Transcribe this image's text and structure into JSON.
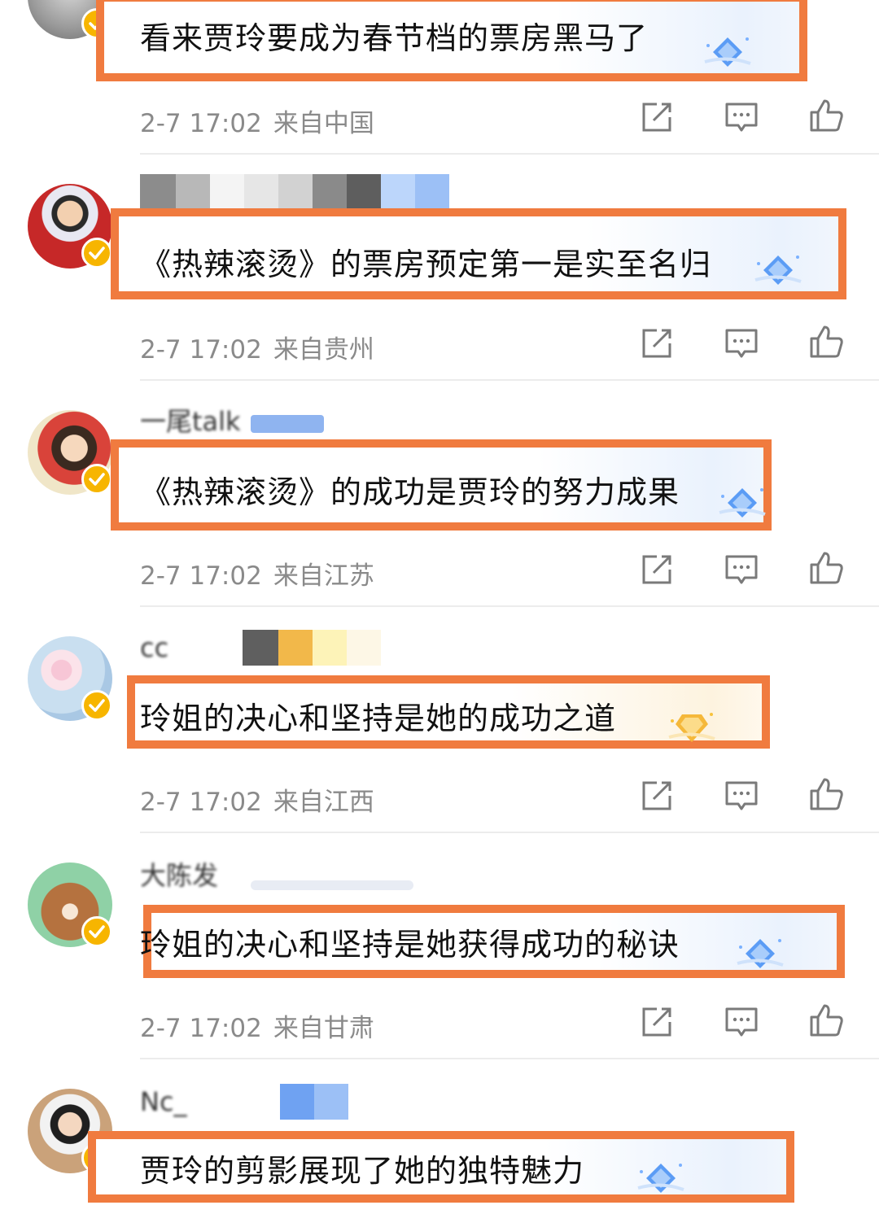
{
  "comments": [
    {
      "text": "看来贾玲要成为春节档的票房黑马了",
      "time": "2-7 17:02",
      "location": "来自中国",
      "badge_color": "#7bb1ff"
    },
    {
      "text": "《热辣滚烫》的票房预定第一是实至名归",
      "time": "2-7 17:02",
      "location": "来自贵州",
      "badge_color": "#7bb1ff"
    },
    {
      "text": "《热辣滚烫》的成功是贾玲的努力成果",
      "time": "2-7 17:02",
      "location": "来自江苏",
      "badge_color": "#7bb1ff"
    },
    {
      "text": "玲姐的决心和坚持是她的成功之道",
      "time": "2-7 17:02",
      "location": "来自江西",
      "badge_color": "#f7c23b"
    },
    {
      "text": "玲姐的决心和坚持是她获得成功的秘诀",
      "time": "2-7 17:02",
      "location": "来自甘肃",
      "badge_color": "#7bb1ff"
    },
    {
      "text": "贾玲的剪影展现了她的独特魅力",
      "time": "",
      "location": "",
      "badge_color": "#7bb1ff"
    }
  ],
  "usernames": {
    "u3": "一尾talk",
    "u4": "cc",
    "u5": "大陈发",
    "u6": "Nc_"
  },
  "icons": {
    "share": "share-icon",
    "comment": "comment-icon",
    "like": "like-icon",
    "verified": "verified-badge-icon",
    "member_gem": "member-gem-icon"
  },
  "colors": {
    "highlight_border": "#f07b3f",
    "meta_text": "#8a8a8a",
    "verified_badge": "#f7b500"
  }
}
